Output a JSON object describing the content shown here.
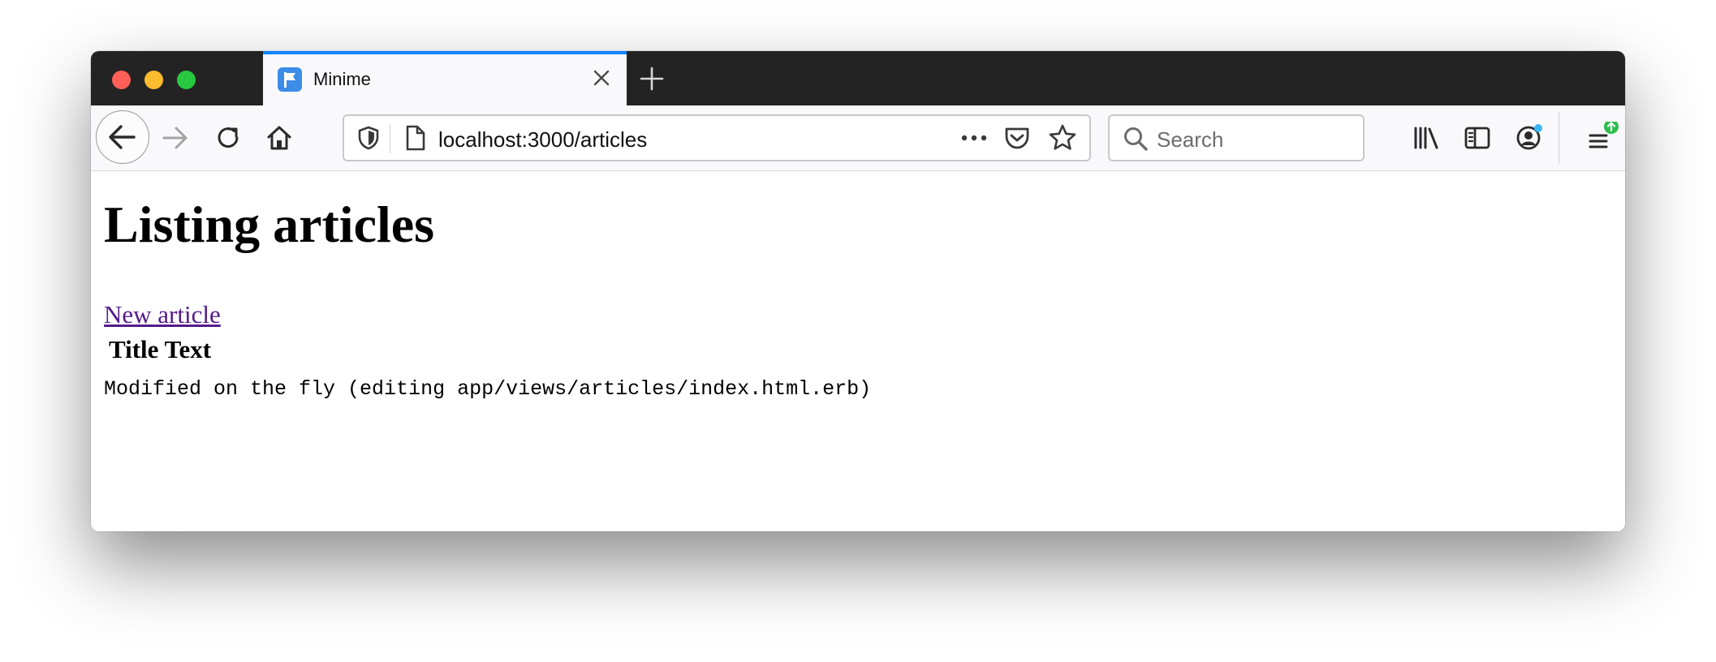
{
  "browser": {
    "tab": {
      "title": "Minime"
    },
    "urlbar": {
      "url": "localhost:3000/articles"
    },
    "searchbar": {
      "placeholder": "Search"
    },
    "colors": {
      "tab_accent": "#0a84ff",
      "favicon": "#3b8de8",
      "notification_dot": "#3ab6f5",
      "update_badge": "#2ebc4f"
    },
    "icons": [
      "back-arrow-icon",
      "forward-arrow-icon",
      "reload-icon",
      "home-icon",
      "shield-icon",
      "page-icon",
      "more-dots-icon",
      "pocket-icon",
      "star-icon",
      "search-icon",
      "library-icon",
      "sidebar-icon",
      "account-icon",
      "hamburger-menu-icon"
    ]
  },
  "page": {
    "heading": "Listing articles",
    "new_article_link": "New article",
    "article": {
      "title": "Title Text",
      "text": "Modified on the fly (editing app/views/articles/index.html.erb)"
    },
    "colors": {
      "visited_link": "#551a8b"
    }
  }
}
